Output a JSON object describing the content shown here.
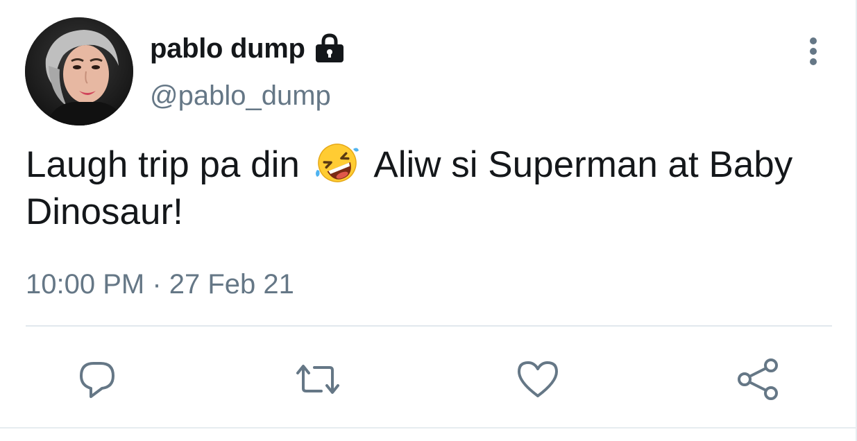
{
  "tweet": {
    "author": {
      "display_name": "pablo dump",
      "handle": "@pablo_dump",
      "protected_icon": "lock-icon",
      "avatar": "profile-photo"
    },
    "text_before_emoji": "Laugh trip pa din",
    "emoji": "rolling-on-the-floor-laughing-emoji",
    "text_after_emoji": "Aliw si Superman at Baby Dinosaur!",
    "timestamp": "10:00 PM · 27 Feb 21",
    "more_icon": "more-vertical-icon",
    "actions": [
      {
        "name": "reply",
        "icon": "reply-icon"
      },
      {
        "name": "retweet",
        "icon": "retweet-icon"
      },
      {
        "name": "like",
        "icon": "heart-icon"
      },
      {
        "name": "share",
        "icon": "share-icon"
      }
    ]
  },
  "colors": {
    "text_primary": "#14171a",
    "text_secondary": "#657786",
    "icon_gray": "#657786",
    "divider": "#e1e8ed"
  }
}
